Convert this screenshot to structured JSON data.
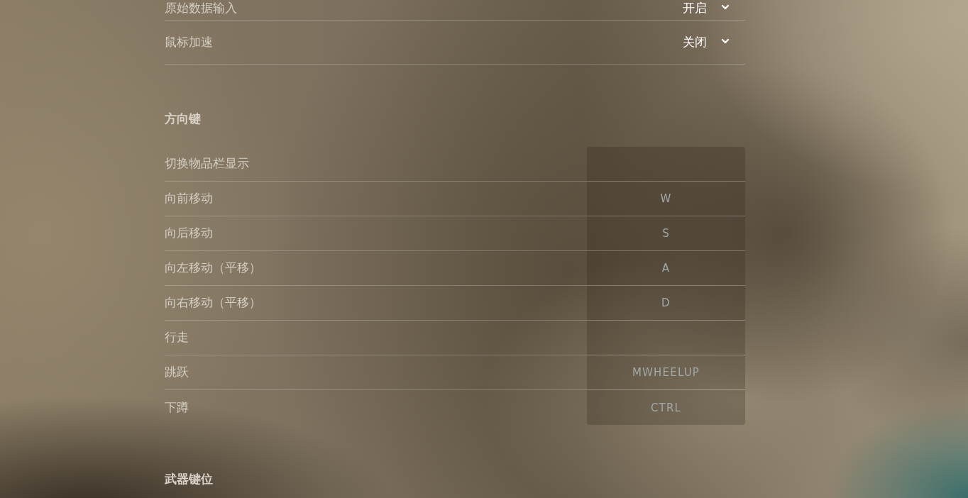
{
  "dropdown_rows": [
    {
      "label": "原始数据输入",
      "value": "开启"
    },
    {
      "label": "鼠标加速",
      "value": "关闭"
    }
  ],
  "sections": [
    {
      "title": "方向键",
      "bindings": [
        {
          "action": "切换物品栏显示"
        },
        {
          "action": "向前移动",
          "key": "W"
        },
        {
          "action": "向后移动",
          "key": "S"
        },
        {
          "action": "向左移动（平移）",
          "key": "A"
        },
        {
          "action": "向右移动（平移）",
          "key": "D"
        },
        {
          "action": "行走"
        },
        {
          "action": "跳跃",
          "key": "MWHEELUP"
        },
        {
          "action": "下蹲",
          "key": "CTRL"
        }
      ]
    },
    {
      "title": "武器键位"
    }
  ]
}
